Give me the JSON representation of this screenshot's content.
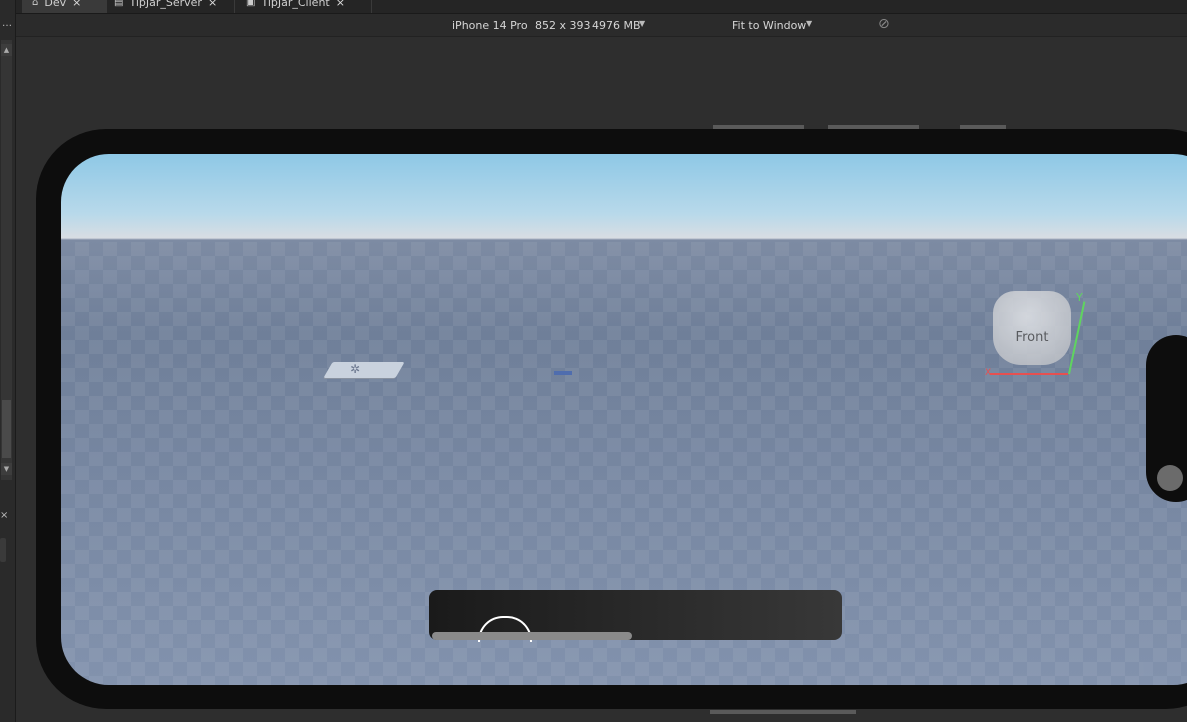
{
  "tabs": [
    {
      "label": "Dev",
      "icon": "place-icon",
      "active": true
    },
    {
      "label": "TipJar_Server",
      "icon": "script-icon",
      "active": false
    },
    {
      "label": "TipJar_Client",
      "icon": "localscript-icon",
      "active": false
    }
  ],
  "device": {
    "name": "iPhone 14 Pro",
    "resolution": "852 x 393",
    "memory": "4976 MB",
    "fit": "Fit to Window"
  },
  "viewcube": {
    "face": "Front",
    "axis_y": "Y",
    "axis_x": "X"
  },
  "colors": {
    "sky": "#8ec8e6",
    "baseplate": "#7d8ba3",
    "axis_y": "#5fd45f",
    "axis_x": "#e65050"
  }
}
